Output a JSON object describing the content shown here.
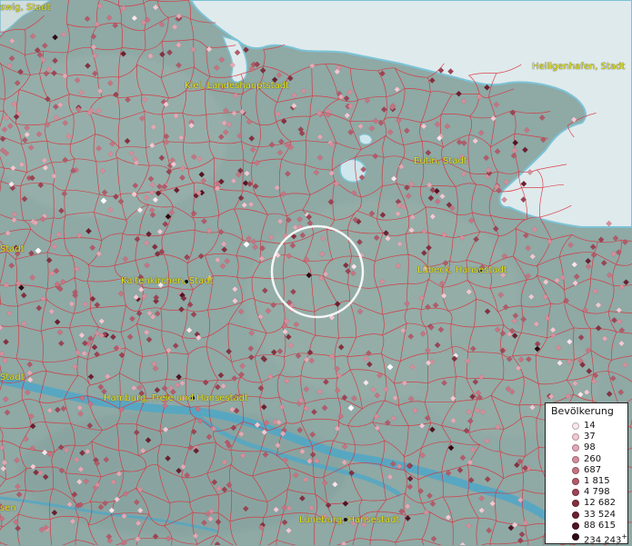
{
  "cities": [
    {
      "name": "Schleswig, Stadt",
      "label": "swig, Stadt"
    },
    {
      "name": "Kiel, Landeshauptstadt",
      "label": "Kiel, Landeshauptstadt"
    },
    {
      "name": "Heiligenhafen, Stadt",
      "label": "Heiligenhafen, Stadt"
    },
    {
      "name": "Eutin, Stadt",
      "label": "Eutin, Stadt"
    },
    {
      "name": "Stadt (left edge)",
      "label": "Stadt"
    },
    {
      "name": "Kaltenkirchen, Stadt",
      "label": "Kaltenkirchen, Stadt"
    },
    {
      "name": "Lübeck, Hansestadt",
      "label": "Lübeck, Hansestadt"
    },
    {
      "name": "Stadt (left edge 2)",
      "label": "Stadt"
    },
    {
      "name": "Hamburg, Freie und Hansestadt",
      "label": "Hamburg, Freie und Hansestadt"
    },
    {
      "name": "sen (left edge)",
      "label": "sen"
    },
    {
      "name": "Lüneburg, Hansestadt",
      "label": "Lüneburg, Hansestadt"
    }
  ],
  "legend": {
    "title": "Bevölkerung",
    "classes": [
      {
        "label": "14",
        "color": "#fbe6ec"
      },
      {
        "label": "37",
        "color": "#f2c9d2"
      },
      {
        "label": "98",
        "color": "#e3a9b4"
      },
      {
        "label": "260",
        "color": "#d58e9b"
      },
      {
        "label": "687",
        "color": "#c67482"
      },
      {
        "label": "1 815",
        "color": "#b25b6a"
      },
      {
        "label": "4 798",
        "color": "#9c4454"
      },
      {
        "label": "12 682",
        "color": "#843140"
      },
      {
        "label": "33 524",
        "color": "#6b2030"
      },
      {
        "label": "88 615",
        "color": "#511422"
      },
      {
        "label": "234 243",
        "color": "#2e0a12"
      }
    ],
    "overflow_marker": "+"
  },
  "colors": {
    "land": "#8fa9a5",
    "sea": "#dfeaec",
    "boundary": "#d9323c",
    "selection_circle": "#ffffff",
    "city_label": "#e8e81a"
  }
}
